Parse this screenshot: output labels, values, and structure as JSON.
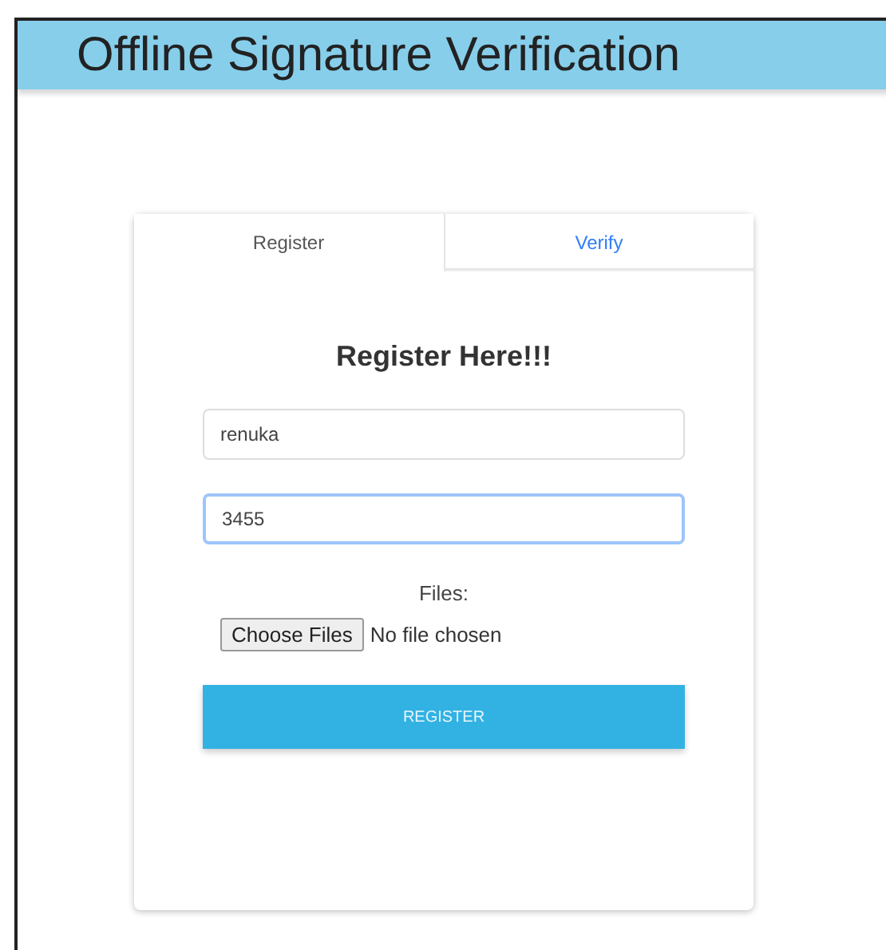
{
  "header": {
    "title": "Offline Signature Verification"
  },
  "tabs": [
    {
      "label": "Register",
      "selected": true
    },
    {
      "label": "Verify",
      "selected": false
    }
  ],
  "form": {
    "heading": "Register Here!!!",
    "fields": [
      {
        "value": "renuka",
        "focused": false
      },
      {
        "value": "3455",
        "focused": true
      }
    ],
    "files_label": "Files:",
    "choose_button": "Choose Files",
    "file_status": "No file chosen",
    "submit": "REGISTER"
  }
}
